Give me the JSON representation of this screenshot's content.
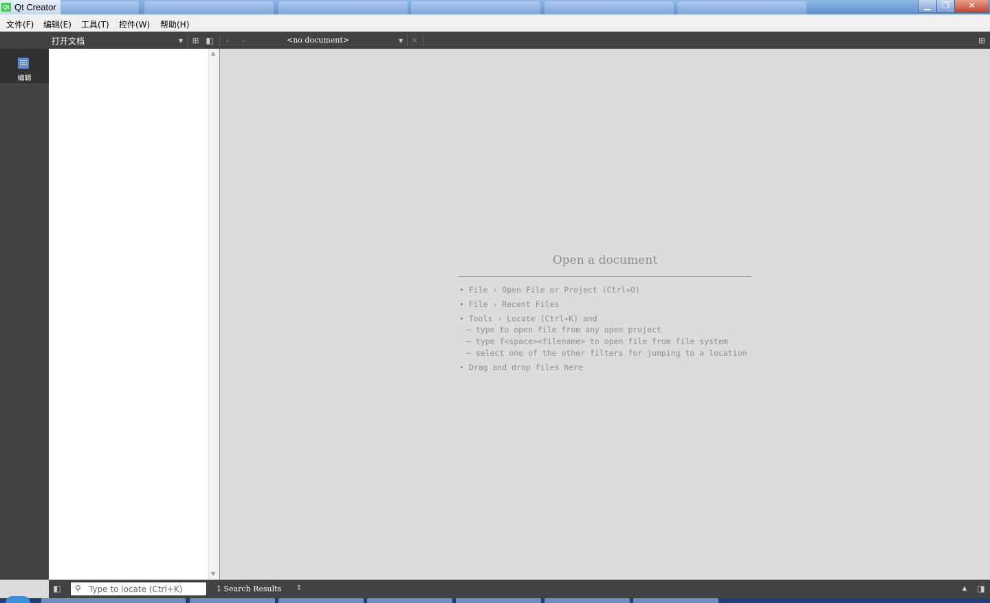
{
  "window": {
    "title": "Qt Creator",
    "app_icon_text": "Qt",
    "minimize_label": "▁",
    "restore_label": "❐",
    "close_label": "✕"
  },
  "menu": {
    "items": [
      "文件(F)",
      "编辑(E)",
      "工具(T)",
      "控件(W)",
      "帮助(H)"
    ]
  },
  "modes": {
    "edit_label": "编辑"
  },
  "open_documents": {
    "title": "打开文档"
  },
  "editor_toolbar": {
    "document_combo": "<no document>"
  },
  "placeholder": {
    "heading": "Open a document",
    "tips": [
      "• File › Open File or Project (Ctrl+O)",
      "• File › Recent Files",
      "• Tools › Locate (Ctrl+K) and",
      "– type to open file from any open project",
      "– type f<space><filename> to open file from file system",
      "– select one of the other filters for jumping to a location",
      "• Drag and drop files here"
    ]
  },
  "statusbar": {
    "locator_placeholder": "Type to locate (Ctrl+K)",
    "search_results": "1  Search Results"
  },
  "colors": {
    "sidebar": "#404244",
    "editor_background": "#dcdcdc",
    "accent": "#5b8ad8"
  }
}
